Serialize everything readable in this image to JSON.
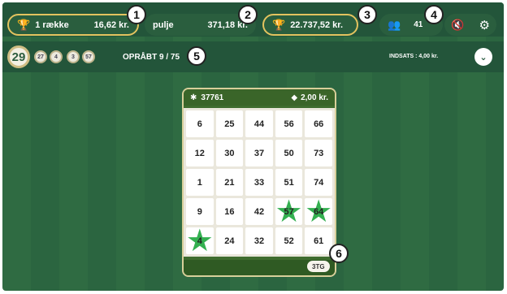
{
  "topbar": {
    "rows": {
      "icon": "trophy-icon",
      "label": "1 række",
      "value": "16,62 kr."
    },
    "pot": {
      "label": "pulje",
      "value": "371,18 kr."
    },
    "jackpot": {
      "icon": "trophy-icon",
      "value": "22.737,52 kr."
    },
    "players": {
      "icon": "users-icon",
      "count": "41"
    },
    "sound": {
      "icon": "mute-icon"
    },
    "settings": {
      "icon": "gear-icon"
    }
  },
  "called": {
    "current_ball": "29",
    "recent_balls": [
      "27",
      "4",
      "3",
      "57"
    ],
    "label": "OPRÅBT 9 / 75",
    "stake": "INDSATS : 4,00 kr.",
    "expand_icon": "chevron-down-icon"
  },
  "ticket": {
    "id": "37761",
    "price": "2,00 kr.",
    "tag": "3TG",
    "rows": [
      [
        {
          "n": "6",
          "marked": false
        },
        {
          "n": "25",
          "marked": false
        },
        {
          "n": "44",
          "marked": false
        },
        {
          "n": "56",
          "marked": false
        },
        {
          "n": "66",
          "marked": false
        }
      ],
      [
        {
          "n": "12",
          "marked": false
        },
        {
          "n": "30",
          "marked": false
        },
        {
          "n": "37",
          "marked": false
        },
        {
          "n": "50",
          "marked": false
        },
        {
          "n": "73",
          "marked": false
        }
      ],
      [
        {
          "n": "1",
          "marked": false
        },
        {
          "n": "21",
          "marked": false
        },
        {
          "n": "33",
          "marked": false
        },
        {
          "n": "51",
          "marked": false
        },
        {
          "n": "74",
          "marked": false
        }
      ],
      [
        {
          "n": "9",
          "marked": false
        },
        {
          "n": "16",
          "marked": false
        },
        {
          "n": "42",
          "marked": false
        },
        {
          "n": "57",
          "marked": true
        },
        {
          "n": "64",
          "marked": true
        }
      ],
      [
        {
          "n": "4",
          "marked": true
        },
        {
          "n": "24",
          "marked": false
        },
        {
          "n": "32",
          "marked": false
        },
        {
          "n": "52",
          "marked": false
        },
        {
          "n": "61",
          "marked": false
        }
      ]
    ]
  },
  "callouts": [
    "1",
    "2",
    "3",
    "4",
    "5",
    "6"
  ],
  "colors": {
    "background": "#2f6b42",
    "bar": "#23553a",
    "gold": "#e3c35f",
    "star": "#33b050"
  }
}
